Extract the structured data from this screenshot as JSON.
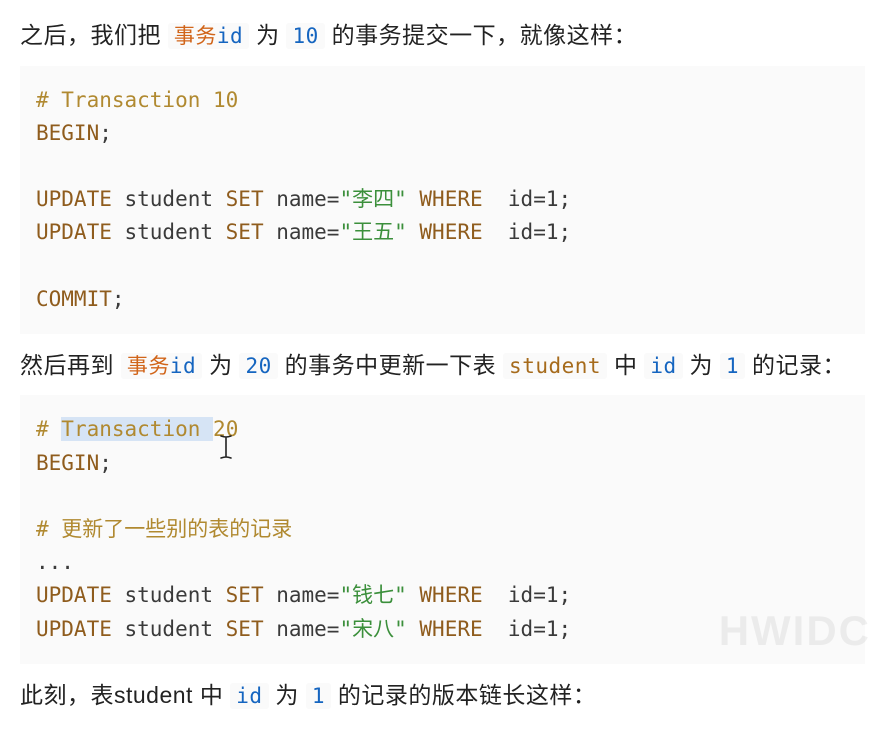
{
  "para1": {
    "t1": "之后，我们把",
    "code1_a": "事务",
    "code1_b": "id",
    "t2": "为",
    "code2": "10",
    "t3": "的事务提交一下，就像这样："
  },
  "code1": {
    "c1": "# Transaction 10",
    "begin": "BEGIN",
    "semi": ";",
    "upd": "UPDATE",
    "set": "SET",
    "where": "WHERE",
    "student": " student ",
    "nameeq": " name=",
    "s_li": "\"李四\"",
    "s_wang": "\"王五\"",
    "idpart": "  id=1;",
    "commit": "COMMIT"
  },
  "para2": {
    "t1": "然后再到",
    "code1_a": "事务",
    "code1_b": "id",
    "t2": "为",
    "code2": "20",
    "t3": "的事务中更新一下表",
    "code3": "student",
    "t4": "中",
    "code4": "id",
    "t5": "为",
    "code5": "1",
    "t6": "的记录："
  },
  "code2": {
    "c1_hash": "# ",
    "c1_word": "Transaction",
    "c1_sp": " ",
    "c1_2": "2",
    "c1_0": "0",
    "begin": "BEGIN",
    "semi": ";",
    "c2": "# 更新了一些别的表的记录",
    "dots": "...",
    "upd": "UPDATE",
    "set": "SET",
    "where": "WHERE",
    "student": " student ",
    "nameeq": " name=",
    "s_qian": "\"钱七\"",
    "s_song": "\"宋八\"",
    "idpart": "  id=1;"
  },
  "para3": {
    "t1": "此刻，表student 中",
    "code1": "id",
    "t2": "为",
    "code2": "1",
    "t3": "的记录的版本链长这样："
  },
  "watermark": "HWIDC"
}
